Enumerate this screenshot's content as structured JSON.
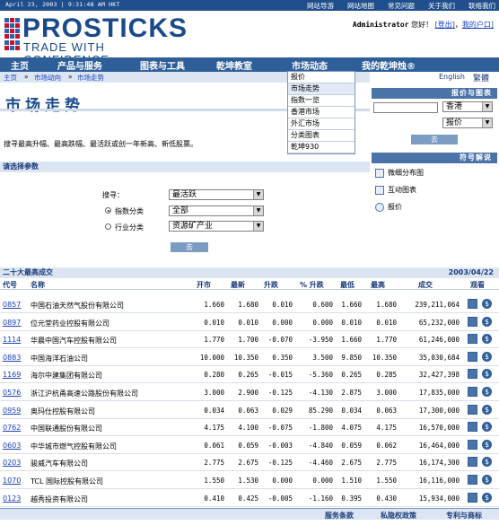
{
  "topbar": {
    "datetime": "April 23, 2003 | 9:31:48 AM HKT",
    "links": [
      "网站导游",
      "网站地图",
      "常见问题",
      "关于我们",
      "联络我们"
    ]
  },
  "logo": {
    "name": "PROSTICKS",
    "tagline": "TRADE WITH CONFIDENCE"
  },
  "user": {
    "name": "Administrator",
    "greeting": "您好！",
    "logout": "[登出]",
    "sep": "，",
    "myaccount": "我的户口]"
  },
  "nav": {
    "items": [
      "主页",
      "产品与服务",
      "图表与工具",
      "乾坤教室",
      "市场动态",
      "我的乾坤烛®"
    ],
    "lang_en": "English",
    "lang_tc": "繁體"
  },
  "breadcrumb": {
    "home": "主页",
    "sep1": "»",
    "section": "市场动向",
    "sep2": "»",
    "page": "市场走势"
  },
  "dropdown": [
    "报价",
    "市场走势",
    "指数一览",
    "香港市场",
    "外汇市场",
    "分类图表",
    "乾坤930"
  ],
  "page": {
    "title": "市场走势",
    "intro": "搜寻最高升幅、最高跌幅、最活跃或创一年新高、新低股票。"
  },
  "params": {
    "header": "请选择参数",
    "search_label": "搜寻：",
    "search_value": "最活跃",
    "index_label": "指数分类",
    "index_value": "全部",
    "industry_label": "行业分类",
    "industry_value": "资源矿产业",
    "go": "去"
  },
  "quote": {
    "header": "报价与图表",
    "market": "香港",
    "type": "报价",
    "go": "去"
  },
  "services": {
    "header": "符号解说",
    "items": [
      "微细分布图",
      "互动图表",
      "报价"
    ]
  },
  "table": {
    "title": "二十大最高成交",
    "date": "2003/04/22",
    "columns": [
      "代号",
      "名称",
      "开市",
      "最新",
      "升跌",
      "% 升跌",
      "最低",
      "最高",
      "成交",
      "观看"
    ],
    "rows": [
      {
        "code": "0857",
        "name": "中国石油天然气股份有限公司",
        "open": "1.660",
        "last": "1.680",
        "chg": "0.010",
        "pct": "0.600",
        "low": "1.660",
        "high": "1.680",
        "vol": "239,211,064"
      },
      {
        "code": "0897",
        "name": "位元堂药业控股有限公司",
        "open": "0.010",
        "last": "0.010",
        "chg": "0.000",
        "pct": "0.000",
        "low": "0.010",
        "high": "0.010",
        "vol": "65,232,000"
      },
      {
        "code": "1114",
        "name": "华晨中国汽车控股有限公司",
        "open": "1.770",
        "last": "1.700",
        "chg": "-0.070",
        "pct": "-3.950",
        "low": "1.660",
        "high": "1.770",
        "vol": "61,246,000"
      },
      {
        "code": "0883",
        "name": "中国海洋石油公司",
        "open": "10.000",
        "last": "10.350",
        "chg": "0.350",
        "pct": "3.500",
        "low": "9.850",
        "high": "10.350",
        "vol": "35,030,684"
      },
      {
        "code": "1169",
        "name": "海尔中建集团有限公司",
        "open": "0.280",
        "last": "0.265",
        "chg": "-0.015",
        "pct": "-5.360",
        "low": "0.265",
        "high": "0.285",
        "vol": "32,427,398"
      },
      {
        "code": "0576",
        "name": "浙江沪杭甬高速公路股份有限公司",
        "open": "3.000",
        "last": "2.900",
        "chg": "-0.125",
        "pct": "-4.130",
        "low": "2.875",
        "high": "3.000",
        "vol": "17,835,000"
      },
      {
        "code": "0959",
        "name": "奥玛仕控股有限公司",
        "open": "0.034",
        "last": "0.063",
        "chg": "0.029",
        "pct": "85.290",
        "low": "0.034",
        "high": "0.063",
        "vol": "17,300,000"
      },
      {
        "code": "0762",
        "name": "中国联通股份有限公司",
        "open": "4.175",
        "last": "4.100",
        "chg": "-0.075",
        "pct": "-1.800",
        "low": "4.075",
        "high": "4.175",
        "vol": "16,570,000"
      },
      {
        "code": "0603",
        "name": "中华城市燃气控股有限公司",
        "open": "0.061",
        "last": "0.059",
        "chg": "-0.003",
        "pct": "-4.840",
        "low": "0.059",
        "high": "0.062",
        "vol": "16,464,000"
      },
      {
        "code": "0203",
        "name": "骏威汽车有限公司",
        "open": "2.775",
        "last": "2.675",
        "chg": "-0.125",
        "pct": "-4.460",
        "low": "2.675",
        "high": "2.775",
        "vol": "16,174,300"
      },
      {
        "code": "1070",
        "name": "TCL 国际控股有限公司",
        "open": "1.550",
        "last": "1.530",
        "chg": "0.000",
        "pct": "0.000",
        "low": "1.510",
        "high": "1.550",
        "vol": "16,116,000"
      },
      {
        "code": "0123",
        "name": "越秀投资有限公司",
        "open": "0.410",
        "last": "0.425",
        "chg": "-0.005",
        "pct": "-1.160",
        "low": "0.395",
        "high": "0.430",
        "vol": "15,934,000"
      }
    ]
  },
  "footer": {
    "links": [
      "服务条款",
      "私隐权政策",
      "专利与商标"
    ]
  },
  "colors": {
    "brand": "#1a4a8a",
    "nav": "#2e5f98",
    "light": "#dce6f2",
    "link": "#1a3fbf"
  }
}
